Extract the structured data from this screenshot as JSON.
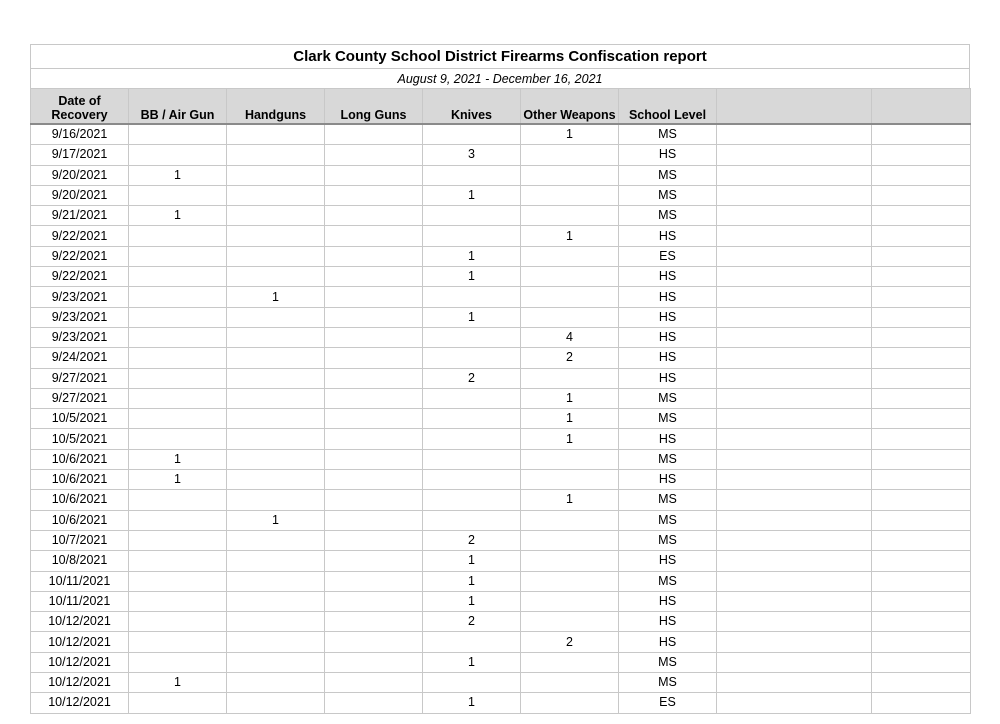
{
  "report": {
    "title": "Clark County School District Firearms Confiscation report",
    "date_range": "August 9, 2021 - December 16, 2021"
  },
  "table": {
    "columns": [
      "Date of Recovery",
      "BB / Air Gun",
      "Handguns",
      "Long Guns",
      "Knives",
      "Other Weapons",
      "School Level",
      "",
      ""
    ],
    "rows": [
      [
        "9/16/2021",
        "",
        "",
        "",
        "",
        "1",
        "MS"
      ],
      [
        "9/17/2021",
        "",
        "",
        "",
        "3",
        "",
        "HS"
      ],
      [
        "9/20/2021",
        "1",
        "",
        "",
        "",
        "",
        "MS"
      ],
      [
        "9/20/2021",
        "",
        "",
        "",
        "1",
        "",
        "MS"
      ],
      [
        "9/21/2021",
        "1",
        "",
        "",
        "",
        "",
        "MS"
      ],
      [
        "9/22/2021",
        "",
        "",
        "",
        "",
        "1",
        "HS"
      ],
      [
        "9/22/2021",
        "",
        "",
        "",
        "1",
        "",
        "ES"
      ],
      [
        "9/22/2021",
        "",
        "",
        "",
        "1",
        "",
        "HS"
      ],
      [
        "9/23/2021",
        "",
        "1",
        "",
        "",
        "",
        "HS"
      ],
      [
        "9/23/2021",
        "",
        "",
        "",
        "1",
        "",
        "HS"
      ],
      [
        "9/23/2021",
        "",
        "",
        "",
        "",
        "4",
        "HS"
      ],
      [
        "9/24/2021",
        "",
        "",
        "",
        "",
        "2",
        "HS"
      ],
      [
        "9/27/2021",
        "",
        "",
        "",
        "2",
        "",
        "HS"
      ],
      [
        "9/27/2021",
        "",
        "",
        "",
        "",
        "1",
        "MS"
      ],
      [
        "10/5/2021",
        "",
        "",
        "",
        "",
        "1",
        "MS"
      ],
      [
        "10/5/2021",
        "",
        "",
        "",
        "",
        "1",
        "HS"
      ],
      [
        "10/6/2021",
        "1",
        "",
        "",
        "",
        "",
        "MS"
      ],
      [
        "10/6/2021",
        "1",
        "",
        "",
        "",
        "",
        "HS"
      ],
      [
        "10/6/2021",
        "",
        "",
        "",
        "",
        "1",
        "MS"
      ],
      [
        "10/6/2021",
        "",
        "1",
        "",
        "",
        "",
        "MS"
      ],
      [
        "10/7/2021",
        "",
        "",
        "",
        "2",
        "",
        "MS"
      ],
      [
        "10/8/2021",
        "",
        "",
        "",
        "1",
        "",
        "HS"
      ],
      [
        "10/11/2021",
        "",
        "",
        "",
        "1",
        "",
        "MS"
      ],
      [
        "10/11/2021",
        "",
        "",
        "",
        "1",
        "",
        "HS"
      ],
      [
        "10/12/2021",
        "",
        "",
        "",
        "2",
        "",
        "HS"
      ],
      [
        "10/12/2021",
        "",
        "",
        "",
        "",
        "2",
        "HS"
      ],
      [
        "10/12/2021",
        "",
        "",
        "",
        "1",
        "",
        "MS"
      ],
      [
        "10/12/2021",
        "1",
        "",
        "",
        "",
        "",
        "MS"
      ],
      [
        "10/12/2021",
        "",
        "",
        "",
        "1",
        "",
        "ES"
      ]
    ]
  }
}
